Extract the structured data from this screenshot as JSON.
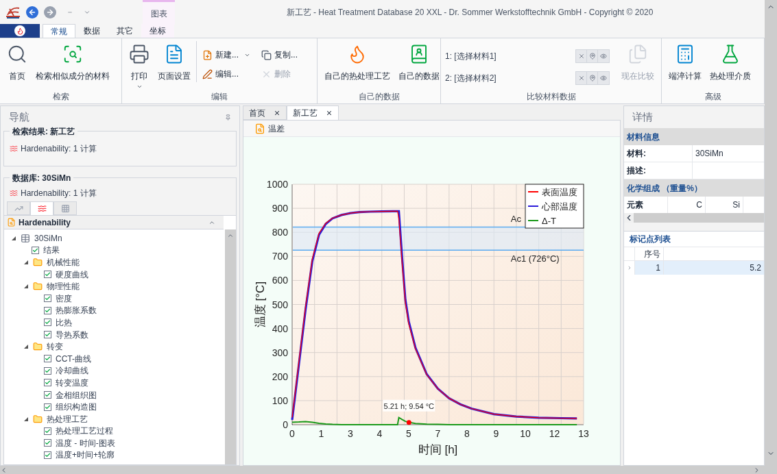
{
  "window": {
    "title": "新工艺 - Heat Treatment Database 20 XXL - Dr. Sommer Werkstofftechnik GmbH - Copyright © 2020",
    "contextual_tab": "图表"
  },
  "ribbon": {
    "tabs": [
      {
        "label": "常规",
        "selected": true
      },
      {
        "label": "数据",
        "selected": false
      },
      {
        "label": "其它",
        "selected": false
      },
      {
        "label": "坐标",
        "selected": false
      }
    ],
    "groups": [
      {
        "label": "检索",
        "items": [
          {
            "kind": "large",
            "label": "首页",
            "disabled": false,
            "menu": false
          },
          {
            "kind": "large",
            "label": "检索相似成分的材料",
            "disabled": false,
            "menu": false
          }
        ]
      },
      {
        "label": "编辑",
        "items": [
          {
            "kind": "large",
            "label": "打印",
            "disabled": false,
            "menu": true
          },
          {
            "kind": "large",
            "label": "页面设置",
            "disabled": false,
            "menu": false
          },
          {
            "kind": "small",
            "label": "新建...",
            "disabled": false,
            "menu": true
          },
          {
            "kind": "small",
            "label": "编辑...",
            "disabled": false,
            "menu": false
          },
          {
            "kind": "small",
            "label": "复制...",
            "disabled": false,
            "menu": false
          },
          {
            "kind": "small",
            "label": "删除",
            "disabled": true,
            "menu": false
          }
        ]
      },
      {
        "label": "自己的数据",
        "items": [
          {
            "kind": "large",
            "label": "自己的热处理工艺",
            "disabled": false,
            "menu": false
          },
          {
            "kind": "large",
            "label": "自己的数据",
            "disabled": false,
            "menu": false
          }
        ]
      },
      {
        "label": "比较材料数据",
        "items": [
          {
            "kind": "slot",
            "label": "1: [选择材料1]",
            "disabled": false
          },
          {
            "kind": "slot",
            "label": "2: [选择材料2]",
            "disabled": false
          },
          {
            "kind": "large",
            "label": "现在比较",
            "disabled": true,
            "menu": false
          }
        ]
      },
      {
        "label": "高级",
        "items": [
          {
            "kind": "large",
            "label": "端淬计算",
            "disabled": false,
            "menu": false
          },
          {
            "kind": "large",
            "label": "热处理介质",
            "disabled": false,
            "menu": false
          }
        ]
      }
    ]
  },
  "navigation": {
    "title": "导航",
    "search_result": {
      "title": "检索结果: 新工艺",
      "item": "Hardenability: 1 计算"
    },
    "database": {
      "title": "数据库: 30SiMn",
      "item": "Hardenability: 1 计算"
    },
    "view_tabs": [
      {
        "selected": false
      },
      {
        "selected": true
      },
      {
        "selected": false
      }
    ],
    "tree_header": "Hardenability",
    "tree": [
      {
        "kind": "root",
        "label": "30SiMn",
        "expanded": true,
        "children": [
          {
            "kind": "leaf",
            "label": "结果",
            "checked": true
          },
          {
            "kind": "folder",
            "label": "机械性能",
            "expanded": true,
            "children": [
              {
                "kind": "leaf",
                "label": "硬度曲线",
                "checked": true
              }
            ]
          },
          {
            "kind": "folder",
            "label": "物理性能",
            "expanded": true,
            "children": [
              {
                "kind": "leaf",
                "label": "密度",
                "checked": true
              },
              {
                "kind": "leaf",
                "label": "热膨胀系数",
                "checked": true
              },
              {
                "kind": "leaf",
                "label": "比热",
                "checked": true
              },
              {
                "kind": "leaf",
                "label": "导热系数",
                "checked": true
              }
            ]
          },
          {
            "kind": "folder",
            "label": "转变",
            "expanded": true,
            "children": [
              {
                "kind": "leaf",
                "label": "CCT-曲线",
                "checked": true
              },
              {
                "kind": "leaf",
                "label": "冷却曲线",
                "checked": true
              },
              {
                "kind": "leaf",
                "label": "转变温度",
                "checked": true
              },
              {
                "kind": "leaf",
                "label": "金相组织图",
                "checked": true
              },
              {
                "kind": "leaf",
                "label": "组织构造图",
                "checked": true
              }
            ]
          },
          {
            "kind": "folder",
            "label": "热处理工艺",
            "expanded": true,
            "children": [
              {
                "kind": "leaf",
                "label": "热处理工艺过程",
                "checked": true
              },
              {
                "kind": "leaf",
                "label": "温度 - 时间-图表",
                "checked": true
              },
              {
                "kind": "leaf",
                "label": "温度+时间+轮廓",
                "checked": true
              }
            ]
          }
        ]
      }
    ]
  },
  "document_tabs": [
    {
      "label": "首页",
      "selected": false
    },
    {
      "label": "新工艺",
      "selected": true
    }
  ],
  "chart_panel": {
    "title": "温差",
    "chart_data": {
      "type": "line",
      "xlabel": "时间 [h]",
      "ylabel": "温度 [°C]",
      "x": [
        0,
        0.3,
        0.6,
        0.9,
        1.2,
        1.5,
        1.8,
        2.2,
        2.6,
        3.0,
        3.5,
        4.0,
        4.5,
        4.7,
        4.76,
        4.9,
        5.05,
        5.2,
        5.5,
        6.0,
        6.5,
        7.0,
        7.5,
        8.0,
        9.0,
        10.0,
        11.0,
        12.0,
        12.7
      ],
      "series": [
        {
          "name": "表面温度",
          "color": "#ff0000",
          "values": [
            30,
            261,
            493,
            690,
            796,
            838,
            859,
            872,
            880,
            884,
            886,
            887,
            888,
            888,
            858,
            678,
            506,
            420,
            315,
            208,
            149,
            110,
            85,
            67,
            44,
            34,
            29,
            27,
            26
          ]
        },
        {
          "name": "心部温度",
          "color": "#2b1bd9",
          "values": [
            20,
            250,
            480,
            680,
            790,
            835,
            858,
            872,
            880,
            884,
            886,
            887,
            888,
            888,
            888,
            700,
            520,
            430,
            320,
            210,
            150,
            110,
            85,
            67,
            44,
            34,
            29,
            27,
            26
          ]
        },
        {
          "name": "Δ-T",
          "color": "#1a9a1a",
          "values": [
            10,
            11,
            13,
            10,
            6,
            3,
            1,
            0,
            0,
            0,
            0,
            0,
            0,
            0,
            30,
            22,
            14,
            10,
            5,
            2,
            1,
            0,
            0,
            0,
            0,
            0,
            0,
            0,
            0
          ]
        }
      ],
      "xlim": [
        0,
        13
      ],
      "ylim": [
        0,
        1000
      ],
      "xticks": [
        {
          "value": 0,
          "label": "0"
        },
        {
          "value": 1.3,
          "label": "1"
        },
        {
          "value": 2.6,
          "label": "3"
        },
        {
          "value": 3.9,
          "label": "4"
        },
        {
          "value": 5.2,
          "label": "5"
        },
        {
          "value": 6.5,
          "label": "7"
        },
        {
          "value": 7.8,
          "label": "8"
        },
        {
          "value": 9.1,
          "label": "9"
        },
        {
          "value": 10.4,
          "label": "10"
        },
        {
          "value": 11.7,
          "label": "12"
        },
        {
          "value": 13,
          "label": "13"
        }
      ],
      "yticks": [
        0,
        100,
        200,
        300,
        400,
        500,
        600,
        700,
        800,
        900,
        1000
      ],
      "grid": true,
      "legend": "upper right",
      "bands": [
        {
          "axis": "y",
          "from": 726,
          "to": 822
        }
      ],
      "ref_lines": [
        {
          "axis": "y",
          "value": 822,
          "label": "Ac"
        },
        {
          "axis": "y",
          "value": 726,
          "label": "Ac1 (726°C)"
        }
      ],
      "annotations": [
        {
          "text": "5.21 h; 9.54 °C",
          "x": 5.21,
          "y": 9.54
        }
      ]
    }
  },
  "details": {
    "title": "详情",
    "material_info": {
      "title": "材料信息",
      "rows": [
        {
          "label": "材料:",
          "value": "30SiMn"
        },
        {
          "label": "描述:"
        }
      ]
    },
    "composition": {
      "title": "化学组成 （重量%）",
      "columns": [
        "元素",
        "C",
        "Si"
      ]
    },
    "markers": {
      "title": "标记点列表",
      "columns": [
        "序号"
      ],
      "rows": [
        {
          "cells": [
            "1",
            "5.2"
          ],
          "selected": true
        }
      ]
    }
  }
}
